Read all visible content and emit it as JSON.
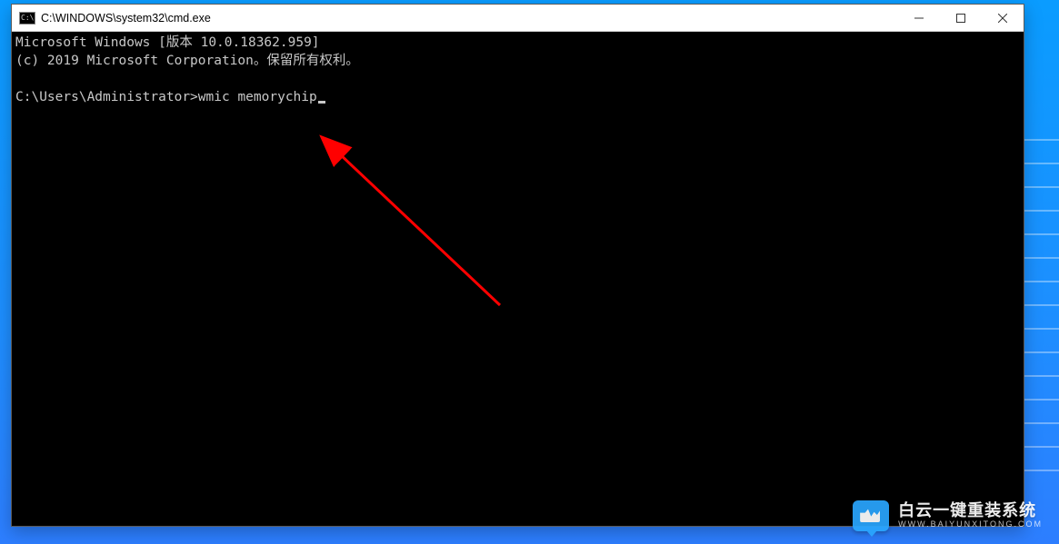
{
  "window": {
    "title": "C:\\WINDOWS\\system32\\cmd.exe",
    "controls": {
      "minimize": "minimize",
      "maximize": "maximize",
      "close": "close"
    }
  },
  "console": {
    "line1": "Microsoft Windows [版本 10.0.18362.959]",
    "line2": "(c) 2019 Microsoft Corporation。保留所有权利。",
    "blank": "",
    "prompt": "C:\\Users\\Administrator>",
    "command": "wmic memorychip"
  },
  "annotation": {
    "arrow_color": "#ff0000"
  },
  "watermark": {
    "main": "白云一键重装系统",
    "sub": "WWW.BAIYUNXITONG.COM"
  }
}
